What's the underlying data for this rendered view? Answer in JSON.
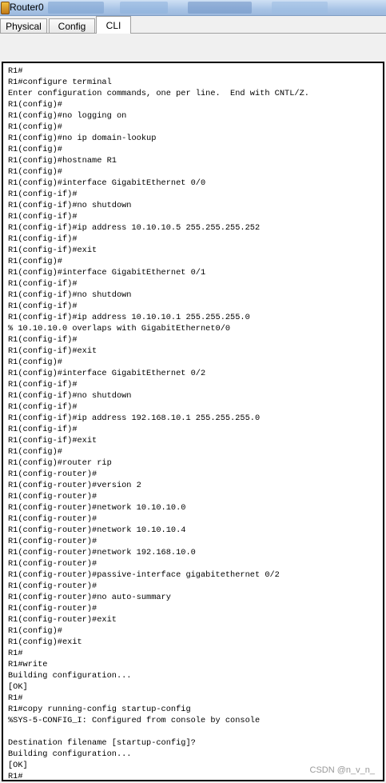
{
  "window": {
    "title": "Router0"
  },
  "tabs": [
    {
      "label": "Physical"
    },
    {
      "label": "Config"
    },
    {
      "label": "CLI"
    }
  ],
  "active_tab": "CLI",
  "console": {
    "lines": [
      "R1#",
      "R1#configure terminal",
      "Enter configuration commands, one per line.  End with CNTL/Z.",
      "R1(config)#",
      "R1(config)#no logging on",
      "R1(config)#",
      "R1(config)#no ip domain-lookup",
      "R1(config)#",
      "R1(config)#hostname R1",
      "R1(config)#",
      "R1(config)#interface GigabitEthernet 0/0",
      "R1(config-if)#",
      "R1(config-if)#no shutdown",
      "R1(config-if)#",
      "R1(config-if)#ip address 10.10.10.5 255.255.255.252",
      "R1(config-if)#",
      "R1(config-if)#exit",
      "R1(config)#",
      "R1(config)#interface GigabitEthernet 0/1",
      "R1(config-if)#",
      "R1(config-if)#no shutdown",
      "R1(config-if)#",
      "R1(config-if)#ip address 10.10.10.1 255.255.255.0",
      "% 10.10.10.0 overlaps with GigabitEthernet0/0",
      "R1(config-if)#",
      "R1(config-if)#exit",
      "R1(config)#",
      "R1(config)#interface GigabitEthernet 0/2",
      "R1(config-if)#",
      "R1(config-if)#no shutdown",
      "R1(config-if)#",
      "R1(config-if)#ip address 192.168.10.1 255.255.255.0",
      "R1(config-if)#",
      "R1(config-if)#exit",
      "R1(config)#",
      "R1(config)#router rip",
      "R1(config-router)#",
      "R1(config-router)#version 2",
      "R1(config-router)#",
      "R1(config-router)#network 10.10.10.0",
      "R1(config-router)#",
      "R1(config-router)#network 10.10.10.4",
      "R1(config-router)#",
      "R1(config-router)#network 192.168.10.0",
      "R1(config-router)#",
      "R1(config-router)#passive-interface gigabitethernet 0/2",
      "R1(config-router)#",
      "R1(config-router)#no auto-summary",
      "R1(config-router)#",
      "R1(config-router)#exit",
      "R1(config)#",
      "R1(config)#exit",
      "R1#",
      "R1#write",
      "Building configuration...",
      "[OK]",
      "R1#",
      "R1#copy running-config startup-config",
      "%SYS-5-CONFIG_I: Configured from console by console",
      "",
      "Destination filename [startup-config]?",
      "Building configuration...",
      "[OK]",
      "R1#"
    ]
  },
  "watermark": "CSDN @n_v_n_"
}
